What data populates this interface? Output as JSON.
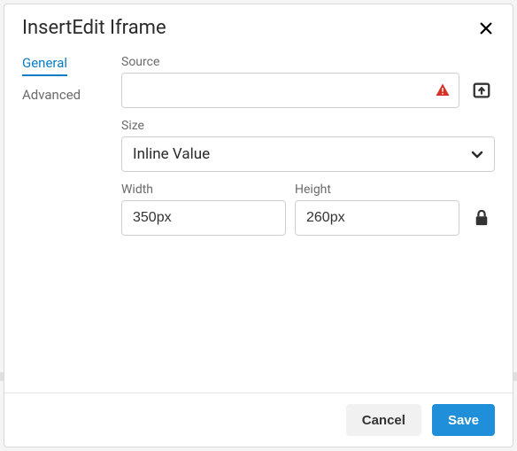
{
  "dialog": {
    "title": "InsertEdit Iframe"
  },
  "tabs": {
    "general": "General",
    "advanced": "Advanced"
  },
  "fields": {
    "source": {
      "label": "Source",
      "value": ""
    },
    "size": {
      "label": "Size",
      "selected": "Inline Value"
    },
    "width": {
      "label": "Width",
      "value": "350px"
    },
    "height": {
      "label": "Height",
      "value": "260px"
    }
  },
  "footer": {
    "cancel": "Cancel",
    "save": "Save"
  }
}
